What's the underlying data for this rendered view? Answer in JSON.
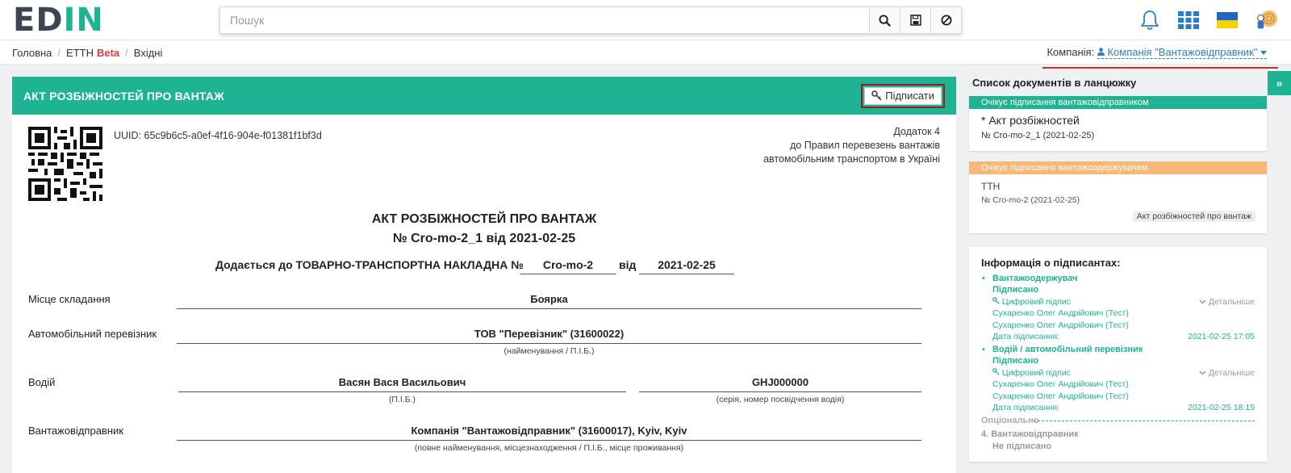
{
  "app": {
    "logo_left": "ED",
    "logo_right": "IN",
    "search_placeholder": "Пошук"
  },
  "topbar": {
    "icons": [
      "search-icon",
      "save-icon",
      "clear-filter-icon",
      "bell-icon",
      "apps-grid-icon",
      "ukraine-flag-icon",
      "user-avatar"
    ]
  },
  "breadcrumb": {
    "items": [
      "Головна",
      "ЕТТН",
      "Вхідні"
    ],
    "beta": "Beta"
  },
  "company": {
    "label": "Компанія:",
    "value": "Компанія \"Вантажовідправник\""
  },
  "document": {
    "header_title": "АКТ РОЗБІЖНОСТЕЙ ПРО ВАНТАЖ",
    "sign_button": "Підписати",
    "uuid": "UUID: 65c9b6c5-a0ef-4f16-904e-f01381f1bf3d",
    "appendix": [
      "Додаток 4",
      "до Правил перевезень вантажів",
      "автомобільним транспортом в Україні"
    ],
    "title_line1": "АКТ РОЗБІЖНОСТЕЙ ПРО ВАНТАЖ",
    "title_line2": "№ Cro-mo-2_1 від 2021-02-25",
    "attach_text": "Додається до ТОВАРНО-ТРАНСПОРТНА НАКЛАДНА №",
    "attach_number": "Cro-mo-2",
    "attach_from": "від",
    "attach_date": "2021-02-25",
    "rows": {
      "place_label": "Місце складання",
      "place_value": "Боярка",
      "carrier_label": "Автомобільний перевізник",
      "carrier_value": "ТОВ \"Перевізник\" (31600022)",
      "carrier_caption": "(найменування / П.І.Б.)",
      "driver_label": "Водій",
      "driver_name": "Васян Вася Васильович",
      "driver_name_caption": "(П.І.Б.)",
      "driver_license": "GHJ000000",
      "driver_license_caption": "(серія, номер посвідчення водія)",
      "shipper_label": "Вантажовідправник",
      "shipper_value": "Компанія \"Вантажовідправник\" (31600017), Kyiv, Kyiv",
      "shipper_caption": "(повне найменування, місцезнаходження / П.І.Б., місце проживання)"
    }
  },
  "sidebar": {
    "title": "Список документів в ланцюжку",
    "card1": {
      "status": "Очікує підписання вантажовідправником",
      "name": "* Акт розбіжностей",
      "number": "№ Cro-mo-2_1 (2021-02-25)"
    },
    "card2": {
      "status": "Очікує підписання вантажоодержувачем",
      "name": "ТТН",
      "number": "№ Cro-mo-2 (2021-02-25)",
      "tag": "Акт розбіжностей про вантаж"
    },
    "signers": {
      "title": "Інформація о підписантах:",
      "list": [
        {
          "role": "Вантажоодержувач",
          "status": "Підписано",
          "sig_type": "Цифровий підпис",
          "more": "Детальніше",
          "person1": "Сухаренко Олег Андрійович (Тест)",
          "person2": "Сухаренко Олег Андрійович (Тест)",
          "date_label": "Дата підписання:",
          "date": "2021-02-25 17:05"
        },
        {
          "role": "Водій / автомобільний перевізник",
          "status": "Підписано",
          "sig_type": "Цифровий підпис",
          "more": "Детальніше",
          "person1": "Сухаренко Олег Андрійович (Тест)",
          "person2": "Сухаренко Олег Андрійович (Тест)",
          "date_label": "Дата підписання:",
          "date": "2021-02-25 18:15"
        }
      ],
      "optional_label": "Опціонально",
      "item4_role": "4.  Вантажовідправник",
      "item4_status": "Не підписано"
    }
  },
  "colors": {
    "accent": "#1db393",
    "warning": "#f5b877",
    "highlight_border": "#9b1c1c",
    "link": "#2a7ec6",
    "beta": "#e23b3b"
  }
}
